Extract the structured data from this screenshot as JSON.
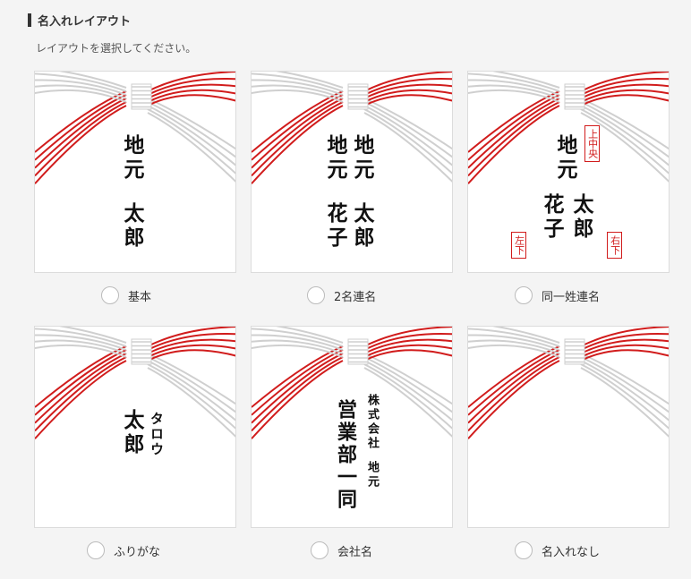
{
  "header": {
    "title": "名入れレイアウト",
    "subtitle": "レイアウトを選択してください。"
  },
  "colors": {
    "cord_red": "#d11c1c",
    "cord_white": "#cfcfcf",
    "stamp_red": "#d11c1c"
  },
  "layouts": [
    {
      "label": "基本",
      "name_family": "地元",
      "name_given": "太郎"
    },
    {
      "label": "2名連名",
      "name_family_1": "地元",
      "name_family_2": "地元",
      "name_given_1": "太郎",
      "name_given_2": "花子"
    },
    {
      "label": "同一姓連名",
      "name_family": "地元",
      "name_given_1": "太郎",
      "name_given_2": "花子",
      "stamp_top": "上中央",
      "stamp_left": "左下",
      "stamp_right": "右下"
    },
    {
      "label": "ふりがな",
      "name": "太郎",
      "furigana": "タロウ"
    },
    {
      "label": "会社名",
      "company": "株式会社",
      "department": "営業部一同",
      "person": "地元"
    },
    {
      "label": "名入れなし"
    }
  ]
}
